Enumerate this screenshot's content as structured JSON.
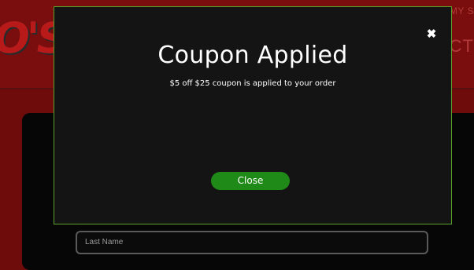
{
  "background": {
    "logo_text": "O'S",
    "nav_top": "MY S",
    "nav_main": "ACT",
    "form": {
      "last_name_placeholder": "Last Name"
    }
  },
  "modal": {
    "title": "Coupon Applied",
    "message": "$5 off $25 coupon is applied to your order",
    "close_icon": "close-icon",
    "close_button_label": "Close",
    "accent_color": "#1f8a17",
    "border_color": "#5aa02c"
  }
}
